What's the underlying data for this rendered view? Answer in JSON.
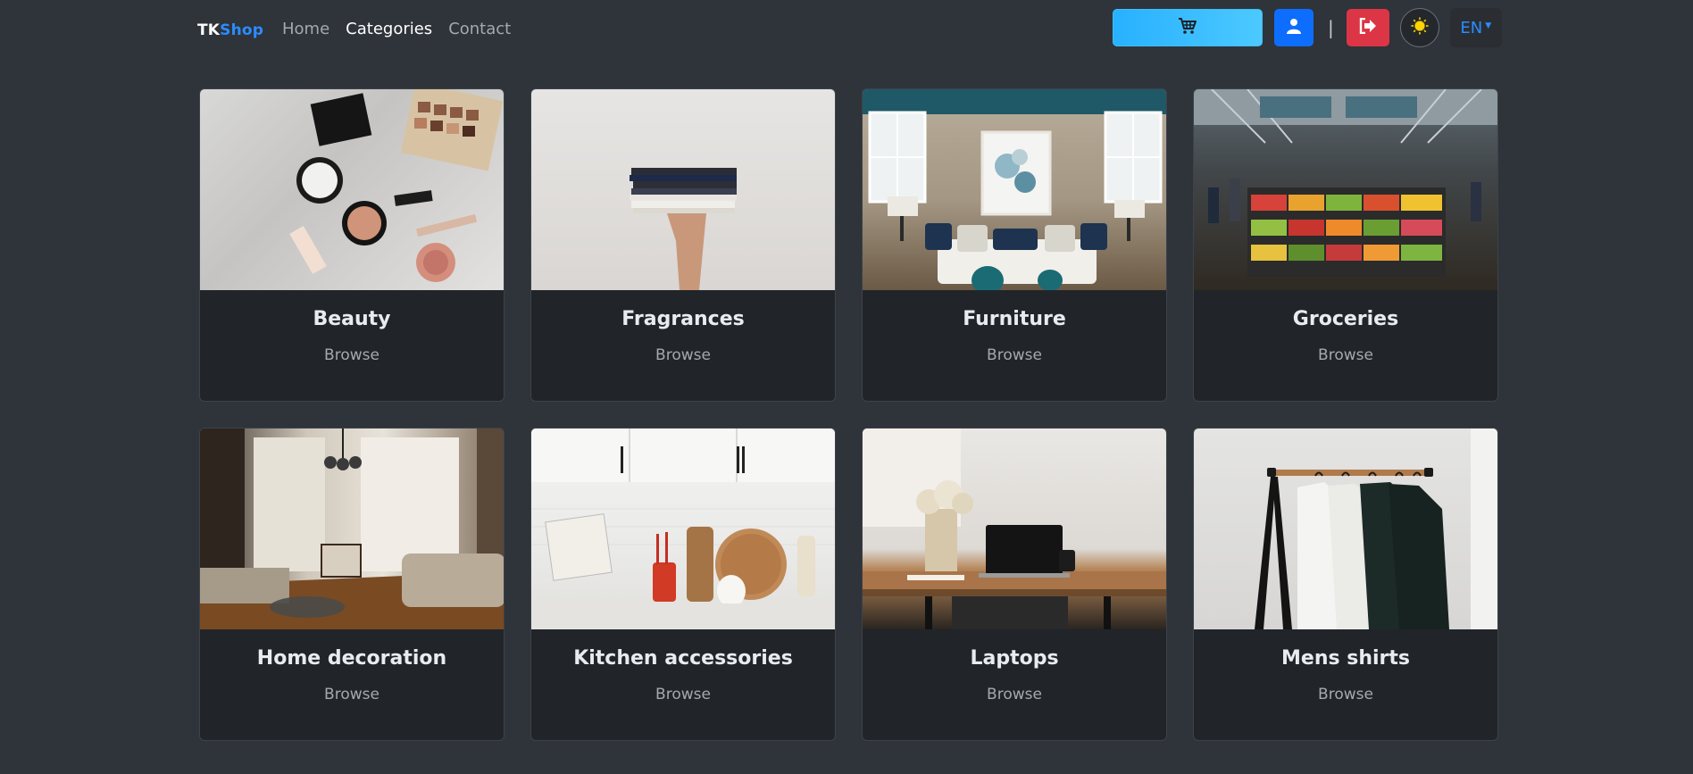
{
  "brand": {
    "part1": "TK",
    "part2": "Shop"
  },
  "nav": [
    {
      "label": "Home",
      "active": false
    },
    {
      "label": "Categories",
      "active": true
    },
    {
      "label": "Contact",
      "active": false
    }
  ],
  "header": {
    "divider": "|",
    "language": "EN",
    "icons": {
      "cart": "shopping-cart-icon",
      "user": "user-icon",
      "logout": "logout-icon",
      "theme": "sun-icon",
      "lang_caret": "caret-down-icon"
    },
    "colors": {
      "cart": "#28b1ff",
      "user": "#0d6efd",
      "logout": "#dc3545",
      "lang": "#2b8cff"
    }
  },
  "categories": [
    {
      "name": "Beauty",
      "action": "Browse"
    },
    {
      "name": "Fragrances",
      "action": "Browse"
    },
    {
      "name": "Furniture",
      "action": "Browse"
    },
    {
      "name": "Groceries",
      "action": "Browse"
    },
    {
      "name": "Home decoration",
      "action": "Browse"
    },
    {
      "name": "Kitchen accessories",
      "action": "Browse"
    },
    {
      "name": "Laptops",
      "action": "Browse"
    },
    {
      "name": "Mens shirts",
      "action": "Browse"
    }
  ]
}
